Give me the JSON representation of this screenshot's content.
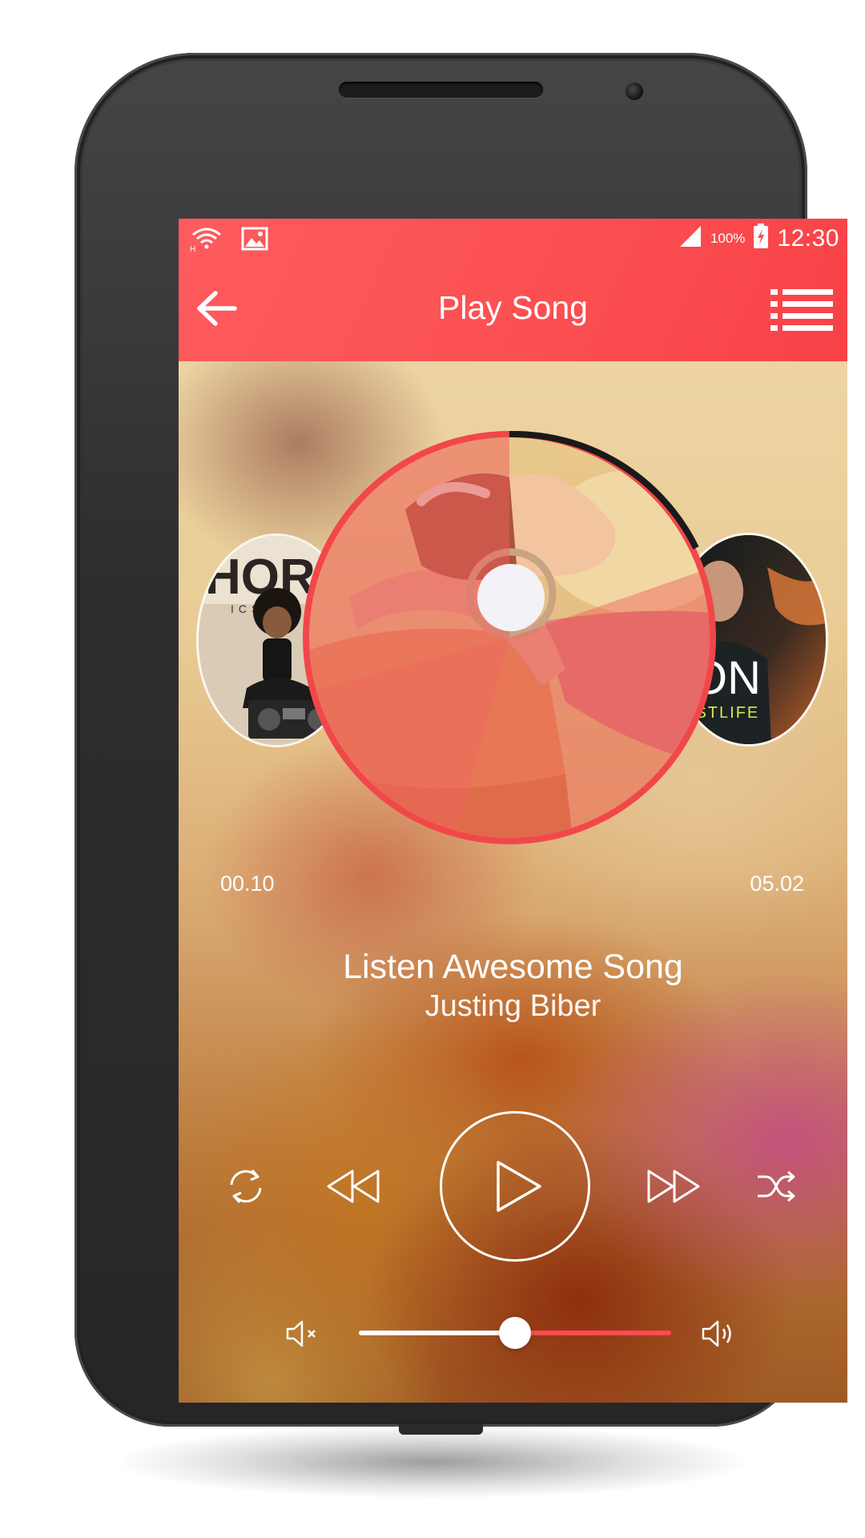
{
  "status_bar": {
    "icons": [
      "wifi-h-icon",
      "image-notification-icon",
      "signal-icon",
      "battery-charging-icon"
    ],
    "battery_percent": "100%",
    "time": "12:30"
  },
  "app_bar": {
    "title": "Play Song",
    "back_icon": "arrow-left-icon",
    "menu_icon": "list-menu-icon",
    "color": "#fb5052"
  },
  "carousel": {
    "previous_album": {
      "art_text": "HOR",
      "art_subtext": "ICS"
    },
    "current_album": {
      "art_icon": "woman-with-headphones-art"
    },
    "next_album": {
      "art_text": "JON",
      "art_subtext": "FASTLIFE"
    }
  },
  "playback": {
    "elapsed": "00.10",
    "duration": "05.02",
    "song_title": "Listen Awesome Song",
    "artist": "Justing Biber"
  },
  "controls": {
    "repeat_icon": "repeat-icon",
    "rewind_icon": "rewind-icon",
    "play_icon": "play-icon",
    "forward_icon": "fast-forward-icon",
    "shuffle_icon": "shuffle-icon"
  },
  "volume": {
    "level": 0.5,
    "mute_icon": "volume-mute-icon",
    "max_icon": "volume-up-icon",
    "fill_color": "#ffffff",
    "track_color": "#ff4b4f"
  },
  "accent_color": "#fb5052"
}
